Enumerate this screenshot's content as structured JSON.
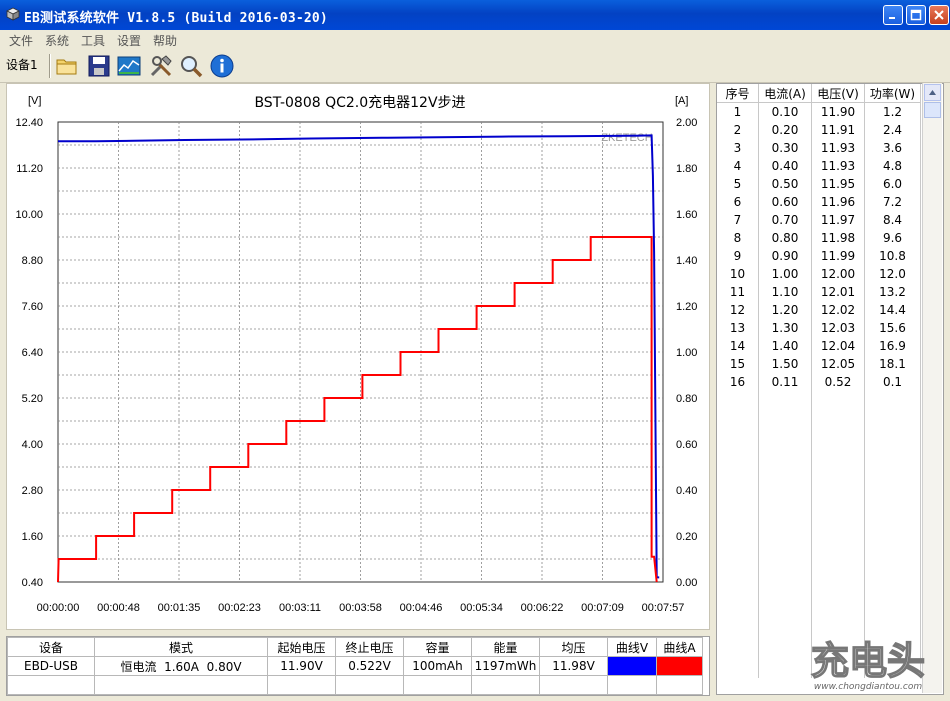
{
  "window": {
    "title": "EB测试系统软件 V1.8.5 (Build 2016-03-20)",
    "buttons": [
      "minimize",
      "maximize",
      "close"
    ]
  },
  "menu": [
    "文件",
    "系统",
    "工具",
    "设置",
    "帮助"
  ],
  "toolbar": {
    "device_tab": "设备1",
    "icons": [
      "folder-icon",
      "save-icon",
      "chart-icon",
      "tools-icon",
      "search-icon",
      "info-icon"
    ]
  },
  "chart_data": {
    "type": "line",
    "title": "BST-0808 QC2.0充电器12V步进",
    "y_left_unit": "[V]",
    "y_right_unit": "[A]",
    "watermark": "ZKETECH",
    "ylim_left": [
      0.4,
      12.4
    ],
    "ylim_right": [
      0.0,
      2.0
    ],
    "y_left_ticks": [
      "12.40",
      "11.20",
      "10.00",
      "8.80",
      "7.60",
      "6.40",
      "5.20",
      "4.00",
      "2.80",
      "1.60",
      "0.40"
    ],
    "y_right_ticks": [
      "2.00",
      "1.80",
      "1.60",
      "1.40",
      "1.20",
      "1.00",
      "0.80",
      "0.60",
      "0.40",
      "0.20",
      "0.00"
    ],
    "x_ticks": [
      "00:00:00",
      "00:00:48",
      "00:01:35",
      "00:02:23",
      "00:03:11",
      "00:03:58",
      "00:04:46",
      "00:05:34",
      "00:06:22",
      "00:07:09",
      "00:07:57"
    ],
    "xlim_seconds": [
      0,
      477
    ],
    "grid": true,
    "series": [
      {
        "color": "#0000cc",
        "axis": "left",
        "x_seconds": [
          0,
          30,
          60,
          100,
          160,
          200,
          260,
          300,
          350,
          400,
          450,
          468,
          469,
          470,
          472,
          474
        ],
        "values": [
          11.9,
          11.9,
          11.91,
          11.93,
          11.95,
          11.97,
          11.99,
          12.0,
          12.02,
          12.03,
          12.04,
          12.05,
          11.0,
          9.0,
          0.52,
          0.52
        ]
      },
      {
        "color": "#ff0000",
        "axis": "right",
        "x_seconds": [
          0,
          0.5,
          30,
          30,
          60,
          60,
          90,
          90,
          120,
          120,
          150,
          150,
          180,
          180,
          210,
          210,
          240,
          240,
          270,
          270,
          300,
          300,
          330,
          330,
          360,
          360,
          390,
          390,
          420,
          420,
          468,
          468,
          470,
          472
        ],
        "values": [
          0.0,
          0.1,
          0.1,
          0.2,
          0.2,
          0.3,
          0.3,
          0.4,
          0.4,
          0.5,
          0.5,
          0.6,
          0.6,
          0.7,
          0.7,
          0.8,
          0.8,
          0.9,
          0.9,
          1.0,
          1.0,
          1.1,
          1.1,
          1.2,
          1.2,
          1.3,
          1.3,
          1.4,
          1.4,
          1.5,
          1.5,
          0.11,
          0.11,
          0.0
        ]
      }
    ]
  },
  "info_table": {
    "headers": [
      "设备",
      "模式",
      "起始电压",
      "终止电压",
      "容量",
      "能量",
      "均压",
      "曲线V",
      "曲线A"
    ],
    "row": {
      "device": "EBD-USB",
      "mode": "恒电流  1.60A  0.80V",
      "start_voltage": "11.90V",
      "end_voltage": "0.522V",
      "capacity": "100mAh",
      "energy": "1197mWh",
      "avg_voltage": "11.98V"
    },
    "curve_v_color": "#0000ff",
    "curve_a_color": "#ff0000"
  },
  "data_table": {
    "headers": [
      "序号",
      "电流(A)",
      "电压(V)",
      "功率(W)"
    ],
    "rows": [
      [
        "1",
        "0.10",
        "11.90",
        "1.2"
      ],
      [
        "2",
        "0.20",
        "11.91",
        "2.4"
      ],
      [
        "3",
        "0.30",
        "11.93",
        "3.6"
      ],
      [
        "4",
        "0.40",
        "11.93",
        "4.8"
      ],
      [
        "5",
        "0.50",
        "11.95",
        "6.0"
      ],
      [
        "6",
        "0.60",
        "11.96",
        "7.2"
      ],
      [
        "7",
        "0.70",
        "11.97",
        "8.4"
      ],
      [
        "8",
        "0.80",
        "11.98",
        "9.6"
      ],
      [
        "9",
        "0.90",
        "11.99",
        "10.8"
      ],
      [
        "10",
        "1.00",
        "12.00",
        "12.0"
      ],
      [
        "11",
        "1.10",
        "12.01",
        "13.2"
      ],
      [
        "12",
        "1.20",
        "12.02",
        "14.4"
      ],
      [
        "13",
        "1.30",
        "12.03",
        "15.6"
      ],
      [
        "14",
        "1.40",
        "12.04",
        "16.9"
      ],
      [
        "15",
        "1.50",
        "12.05",
        "18.1"
      ],
      [
        "16",
        "0.11",
        "0.52",
        "0.1"
      ]
    ]
  },
  "watermark": {
    "logo_text": "充电头",
    "url": "www.chongdiantou.com"
  }
}
